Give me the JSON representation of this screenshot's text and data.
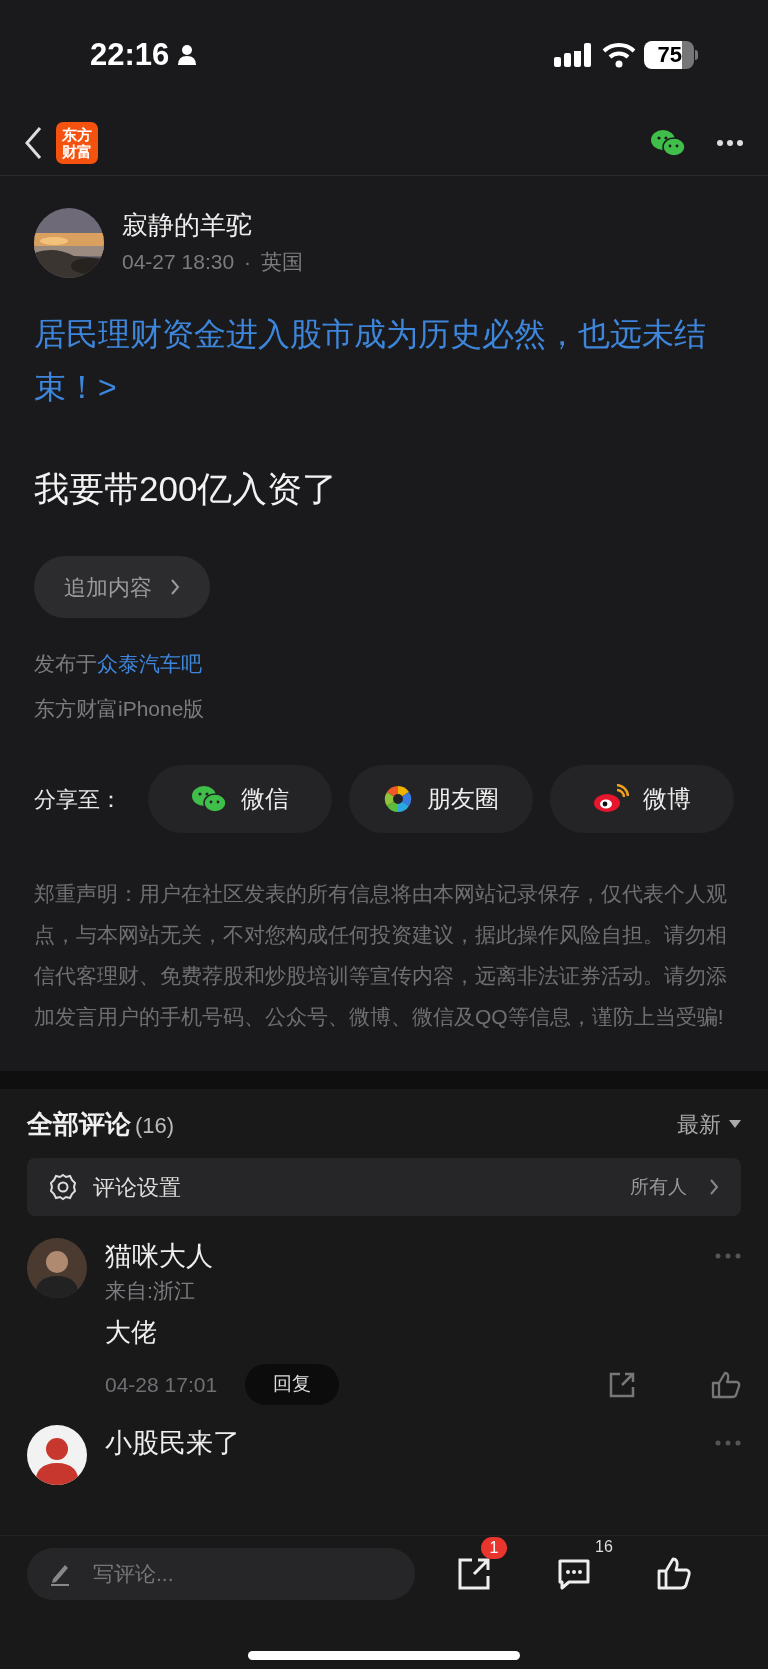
{
  "status_bar": {
    "time": "22:16",
    "battery": "75"
  },
  "nav": {
    "logo_lines": [
      "东方",
      "财富"
    ]
  },
  "post": {
    "author": "寂静的羊驼",
    "time": "04-27 18:30",
    "location": "英国",
    "separator": "·",
    "title": "居民理财资金进入股市成为历史必然，也远未结束！>",
    "body": "我要带200亿入资了",
    "add_button": "追加内容",
    "published_prefix": "发布于",
    "forum": "众泰汽车吧",
    "source": "东方财富iPhone版"
  },
  "share": {
    "label": "分享至：",
    "targets": [
      {
        "kind": "wechat",
        "label": "微信"
      },
      {
        "kind": "moments",
        "label": "朋友圈"
      },
      {
        "kind": "weibo",
        "label": "微博"
      }
    ]
  },
  "disclaimer": "郑重声明：用户在社区发表的所有信息将由本网站记录保存，仅代表个人观点，与本网站无关，不对您构成任何投资建议，据此操作风险自担。请勿相信代客理财、免费荐股和炒股培训等宣传内容，远离非法证券活动。请勿添加发言用户的手机号码、公众号、微博、微信及QQ等信息，谨防上当受骗!",
  "comments_header": {
    "title": "全部评论",
    "count": "(16)",
    "sort": "最新"
  },
  "comment_settings": {
    "label": "评论设置",
    "value": "所有人"
  },
  "comments": [
    {
      "author": "猫咪大人",
      "location": "来自:浙江",
      "text": "大佬",
      "time": "04-28 17:01",
      "reply": "回复"
    },
    {
      "author": "小股民来了"
    }
  ],
  "bottom_bar": {
    "placeholder": "写评论...",
    "share_badge": "1",
    "comment_count": "16"
  }
}
